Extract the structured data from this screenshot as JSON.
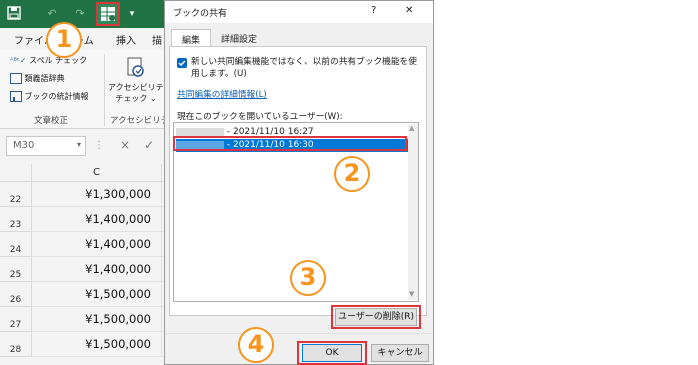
{
  "excel": {
    "qat": {
      "save_icon": "save-icon",
      "undo_icon": "undo-icon",
      "redo_icon": "redo-icon",
      "share_icon": "share-workbook-icon",
      "more_icon": "customize-qat-icon"
    },
    "tabs": [
      "ファイル",
      "ホーム",
      "挿入",
      "描"
    ],
    "ribbon": {
      "spell": "スペル チェック",
      "thesaurus": "類義語辞典",
      "stats": "ブックの統計情報",
      "group_proofing": "文章校正",
      "access_check_line1": "アクセシビリティ",
      "access_check_line2": "チェック ⌄",
      "group_access": "アクセシビリティ"
    },
    "namebox": "M30",
    "formula_x": "×",
    "formula_check": "✓",
    "col_header": "C",
    "rows": [
      {
        "num": "22",
        "value": "¥1,300,000"
      },
      {
        "num": "23",
        "value": "¥1,400,000"
      },
      {
        "num": "24",
        "value": "¥1,400,000"
      },
      {
        "num": "25",
        "value": "¥1,400,000"
      },
      {
        "num": "26",
        "value": "¥1,500,000"
      },
      {
        "num": "27",
        "value": "¥1,500,000"
      },
      {
        "num": "28",
        "value": "¥1,500,000"
      }
    ]
  },
  "dialog": {
    "title": "ブックの共有",
    "help": "?",
    "close": "✕",
    "tab_edit": "編集",
    "tab_advanced": "詳細設定",
    "checkbox_label": "新しい共同編集機能ではなく、以前の共有ブック機能を使用します。(U)",
    "checkbox_checked": true,
    "link": "共同編集の詳細情報(L)",
    "users_label": "現在このブックを開いているユーザー(W):",
    "users": [
      {
        "name_redacted": true,
        "time": "- 2021/11/10 16:27",
        "selected": false
      },
      {
        "name_redacted": true,
        "time": "- 2021/11/10 16:30",
        "selected": true
      }
    ],
    "remove_user": "ユーザーの削除(R)",
    "ok": "OK",
    "cancel": "キャンセル"
  },
  "annotations": [
    "1",
    "2",
    "3",
    "4"
  ],
  "colors": {
    "excel_green": "#217346",
    "select_blue": "#0078d7",
    "callout_red": "#e0343d",
    "badge_orange": "#f7941d"
  }
}
